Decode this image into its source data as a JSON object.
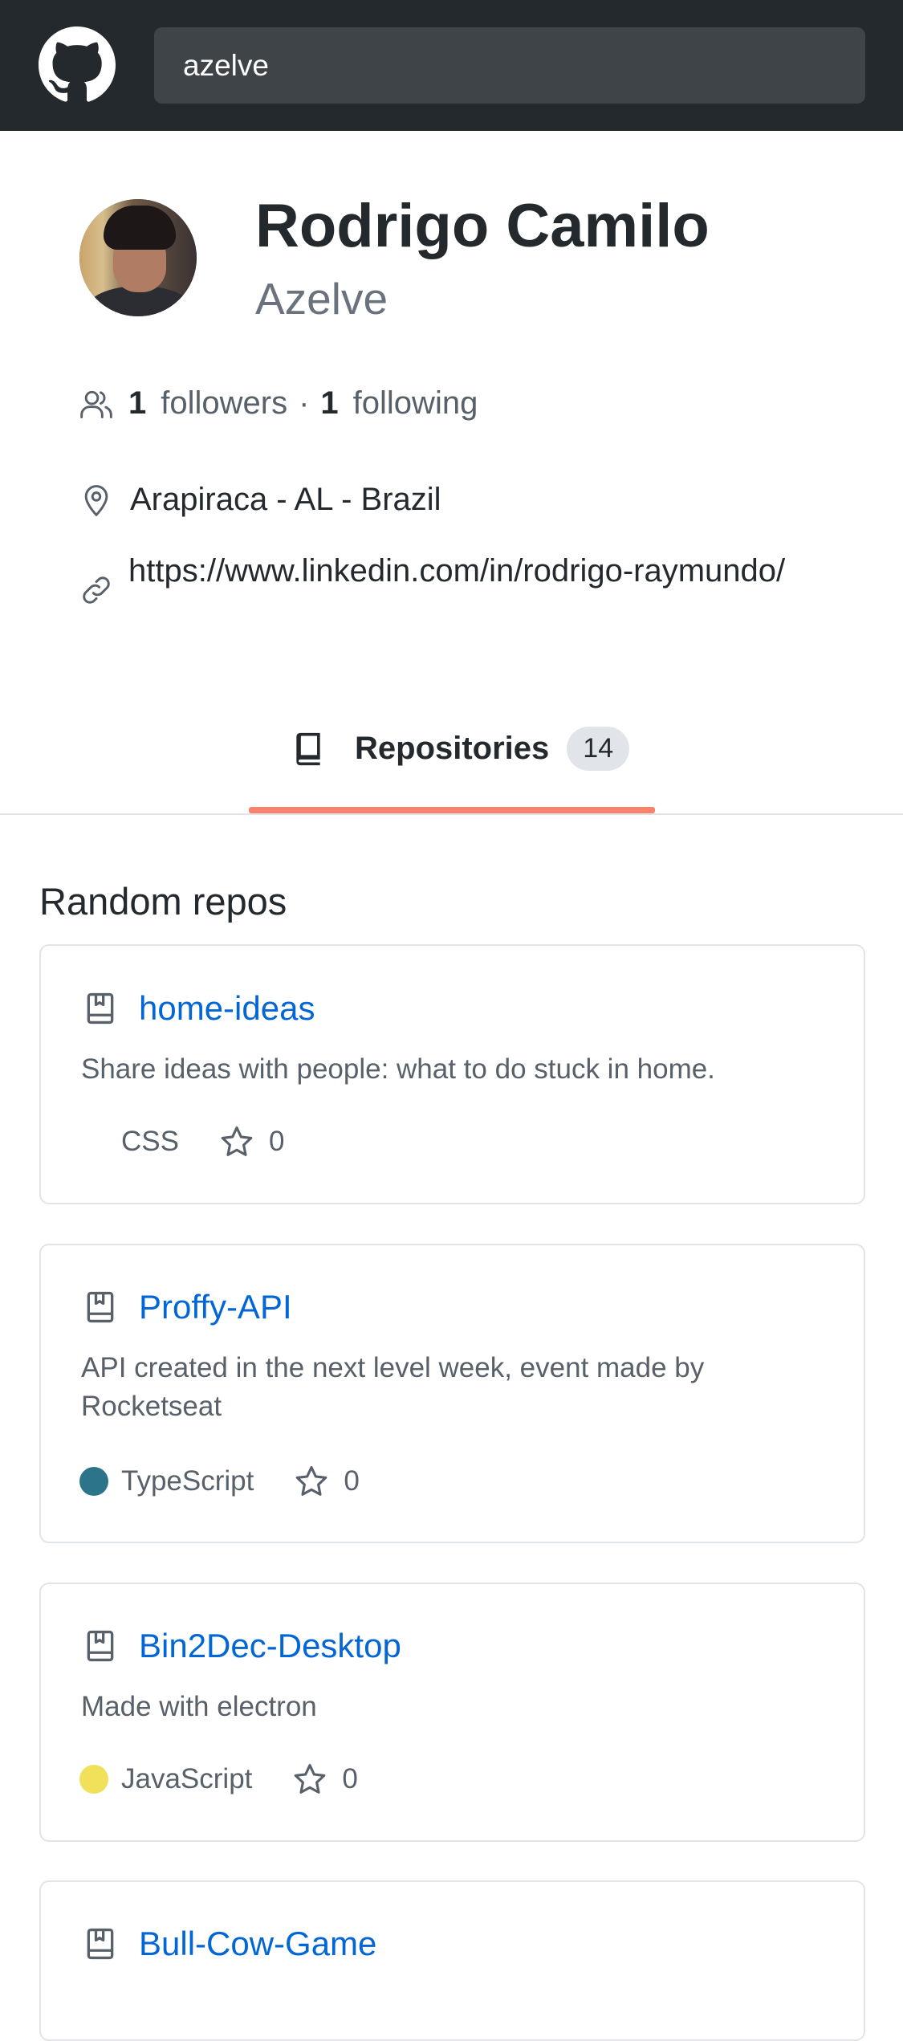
{
  "search": {
    "value": "azelve"
  },
  "profile": {
    "name": "Rodrigo Camilo",
    "login": "Azelve",
    "followers_count": "1",
    "followers_label": "followers",
    "separator": "·",
    "following_count": "1",
    "following_label": "following",
    "location": "Arapiraca - AL - Brazil",
    "website": "https://www.linkedin.com/in/rodrigo-raymundo/"
  },
  "tabs": [
    {
      "label": "Repositories",
      "count": "14",
      "active": true
    }
  ],
  "section_title": "Random repos",
  "repos": [
    {
      "name": "home-ideas",
      "description": "Share ideas with people: what to do stuck in home.",
      "language": "CSS",
      "language_color": "",
      "stars": "0"
    },
    {
      "name": "Proffy-API",
      "description": "API created in the next level week, event made by Rocketseat",
      "language": "TypeScript",
      "language_color": "#2b7489",
      "stars": "0"
    },
    {
      "name": "Bin2Dec-Desktop",
      "description": "Made with electron",
      "language": "JavaScript",
      "language_color": "#f1e05a",
      "stars": "0"
    },
    {
      "name": "Bull-Cow-Game",
      "description": "",
      "language": "",
      "language_color": "",
      "stars": ""
    }
  ],
  "colors": {
    "header_bg": "#24292e",
    "link_blue": "#0366d6",
    "tab_accent": "#f9826c"
  }
}
